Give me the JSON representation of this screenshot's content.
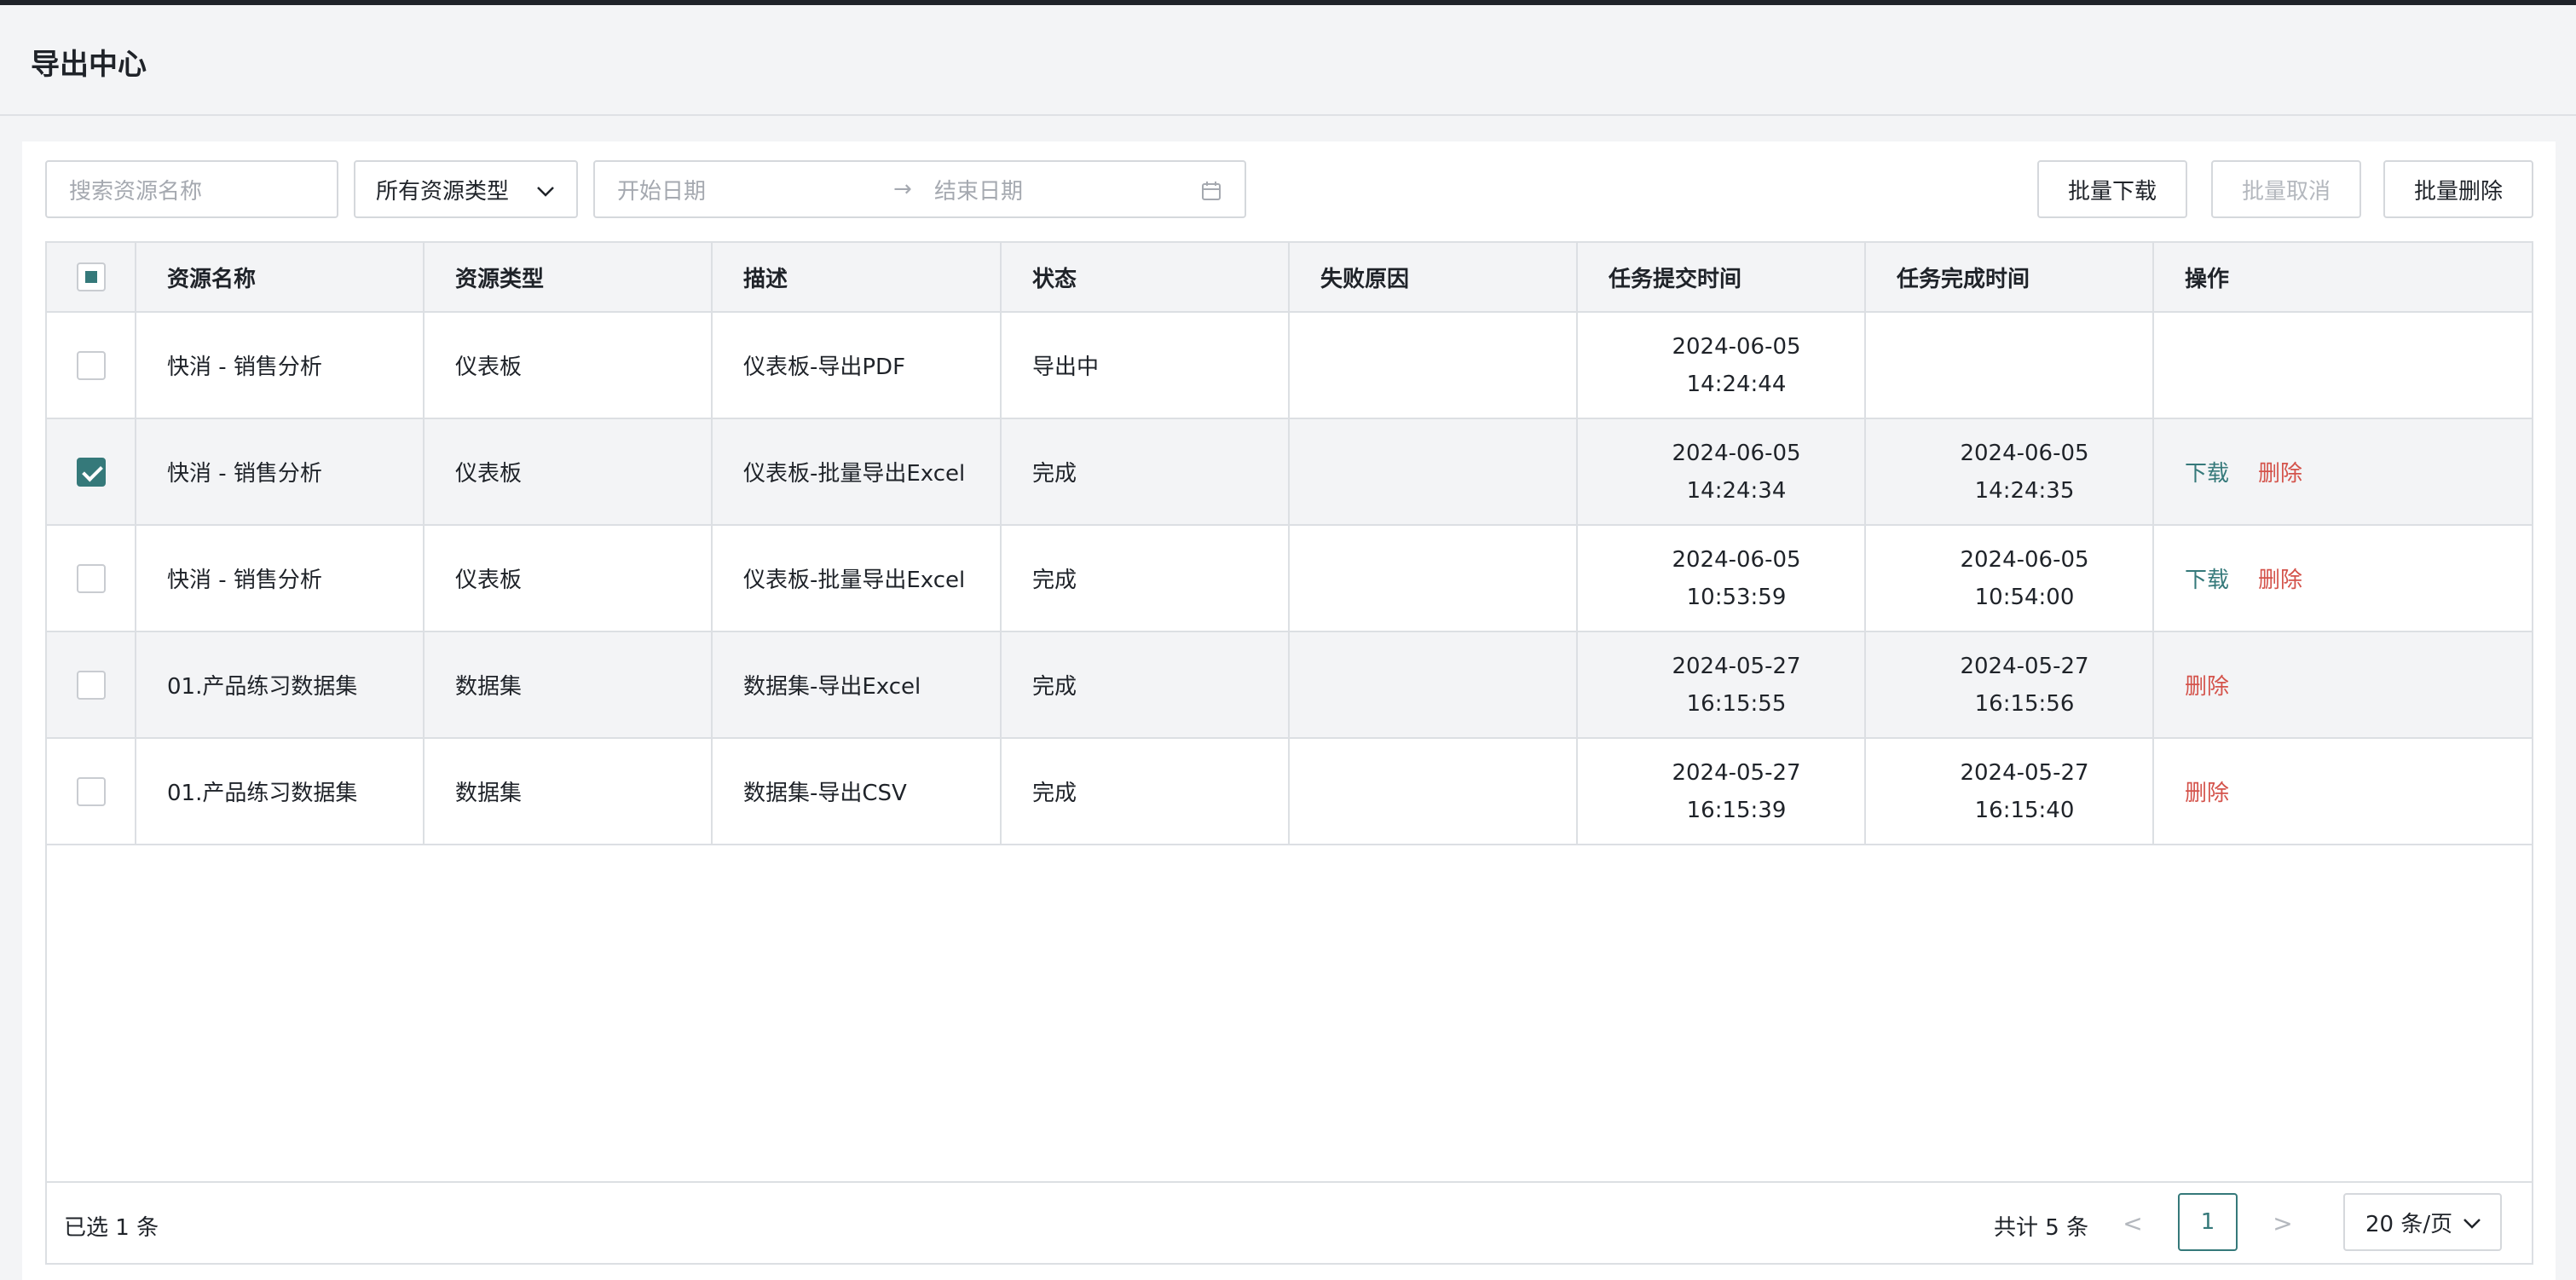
{
  "header": {
    "title": "导出中心"
  },
  "toolbar": {
    "search_placeholder": "搜索资源名称",
    "resource_type": "所有资源类型",
    "date_start_placeholder": "开始日期",
    "date_arrow": "→",
    "date_end_placeholder": "结束日期",
    "batch_download": "批量下载",
    "batch_cancel": "批量取消",
    "batch_delete": "批量删除"
  },
  "table": {
    "columns": [
      "资源名称",
      "资源类型",
      "描述",
      "状态",
      "失败原因",
      "任务提交时间",
      "任务完成时间",
      "操作"
    ],
    "rows": [
      {
        "name": "快消 - 销售分析",
        "type": "仪表板",
        "desc": "仪表板-导出PDF",
        "status": "导出中",
        "reason": "",
        "submit_date": "2024-06-05",
        "submit_time": "14:24:44",
        "finish_date": "",
        "finish_time": "",
        "download": "",
        "delete": "",
        "checked": false
      },
      {
        "name": "快消 - 销售分析",
        "type": "仪表板",
        "desc": "仪表板-批量导出Excel",
        "status": "完成",
        "reason": "",
        "submit_date": "2024-06-05",
        "submit_time": "14:24:34",
        "finish_date": "2024-06-05",
        "finish_time": "14:24:35",
        "download": "下载",
        "delete": "删除",
        "checked": true
      },
      {
        "name": "快消 - 销售分析",
        "type": "仪表板",
        "desc": "仪表板-批量导出Excel",
        "status": "完成",
        "reason": "",
        "submit_date": "2024-06-05",
        "submit_time": "10:53:59",
        "finish_date": "2024-06-05",
        "finish_time": "10:54:00",
        "download": "下载",
        "delete": "删除",
        "checked": false
      },
      {
        "name": "01.产品练习数据集",
        "type": "数据集",
        "desc": "数据集-导出Excel",
        "status": "完成",
        "reason": "",
        "submit_date": "2024-05-27",
        "submit_time": "16:15:55",
        "finish_date": "2024-05-27",
        "finish_time": "16:15:56",
        "download": "",
        "delete": "删除",
        "checked": false
      },
      {
        "name": "01.产品练习数据集",
        "type": "数据集",
        "desc": "数据集-导出CSV",
        "status": "完成",
        "reason": "",
        "submit_date": "2024-05-27",
        "submit_time": "16:15:39",
        "finish_date": "2024-05-27",
        "finish_time": "16:15:40",
        "download": "",
        "delete": "删除",
        "checked": false
      }
    ]
  },
  "footer": {
    "selected_text": "已选 1 条",
    "total_text": "共计 5 条",
    "prev": "<",
    "current_page": "1",
    "next": ">",
    "page_size": "20 条/页"
  },
  "colors": {
    "accent": "#35797a",
    "danger": "#d4534b"
  }
}
